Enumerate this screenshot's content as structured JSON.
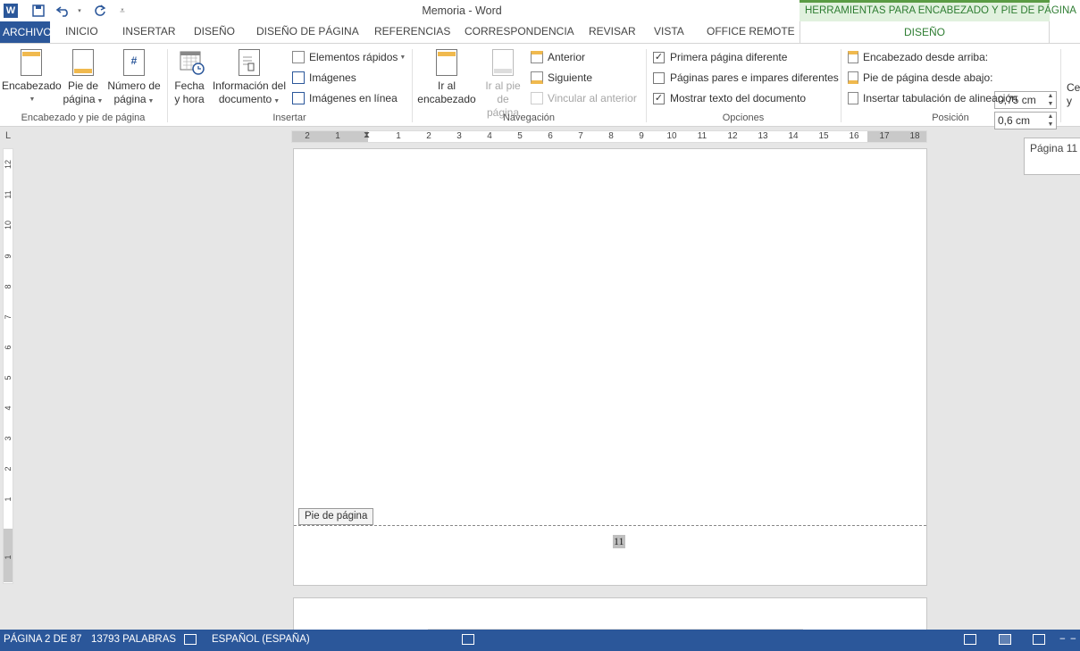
{
  "titlebar": {
    "title": "Memoria - Word",
    "tools_header": "HERRAMIENTAS PARA ENCABEZADO Y PIE DE PÁGINA",
    "qat": {
      "word_logo": "W",
      "save_icon": "save-icon",
      "undo_icon": "undo-icon",
      "redo_icon": "redo-icon",
      "customize_icon": "customize-icon"
    }
  },
  "tabs": {
    "archivo": "ARCHIVO",
    "items": [
      "INICIO",
      "INSERTAR",
      "DISEÑO",
      "DISEÑO DE PÁGINA",
      "REFERENCIAS",
      "CORRESPONDENCIA",
      "REVISAR",
      "VISTA",
      "OFFICE REMOTE"
    ],
    "tools_tab": "DISEÑO"
  },
  "ribbon": {
    "header_footer_group": {
      "label": "Encabezado y pie de página",
      "encabezado": "Encabezado",
      "pie_line1": "Pie de",
      "pie_line2": "página",
      "numero_line1": "Número de",
      "numero_line2": "página",
      "numero_symbol": "#"
    },
    "insert_group": {
      "label": "Insertar",
      "fecha_line1": "Fecha",
      "fecha_line2": "y hora",
      "info_line1": "Información del",
      "info_line2": "documento",
      "elementos": "Elementos rápidos",
      "imagenes": "Imágenes",
      "imagenes_linea": "Imágenes en línea"
    },
    "navigation_group": {
      "label": "Navegación",
      "ir_encabezado_line1": "Ir al",
      "ir_encabezado_line2": "encabezado",
      "ir_pie_line1": "Ir al pie",
      "ir_pie_line2": "de página",
      "anterior": "Anterior",
      "siguiente": "Siguiente",
      "vincular": "Vincular al anterior"
    },
    "options_group": {
      "label": "Opciones",
      "primera": {
        "label": "Primera página diferente",
        "checked": "✓"
      },
      "pares": {
        "label": "Páginas pares e impares diferentes",
        "checked": ""
      },
      "mostrar": {
        "label": "Mostrar texto del documento",
        "checked": "✓"
      }
    },
    "position_group": {
      "label": "Posición",
      "encabezado_label": "Encabezado desde arriba:",
      "encabezado_value": "0,75 cm",
      "pie_label": "Pie de página desde abajo:",
      "pie_value": "0,6 cm",
      "tabulacion": "Insertar tabulación de alineación"
    },
    "overflow_line1": "Ce",
    "overflow_line2": "y"
  },
  "ruler": {
    "corner": "L",
    "h_numbers": [
      "2",
      "1",
      "1",
      "2",
      "3",
      "4",
      "5",
      "6",
      "7",
      "8",
      "9",
      "10",
      "11",
      "12",
      "13",
      "14",
      "15",
      "16",
      "17",
      "18"
    ],
    "v_numbers": [
      "12",
      "11",
      "10",
      "9",
      "8",
      "7",
      "6",
      "5",
      "4",
      "3",
      "2",
      "1",
      "1"
    ]
  },
  "document": {
    "footer_tag": "Pie de página",
    "page_number": "11",
    "tooltip": "Página 11"
  },
  "statusbar": {
    "page": "PÁGINA 2 DE 87",
    "words": "13793 PALABRAS",
    "language": "ESPAÑOL (ESPAÑA)"
  },
  "colors": {
    "accent": "#2b579a",
    "tools_green": "#2e7d32",
    "tools_header_bg": "#e1f1de"
  }
}
